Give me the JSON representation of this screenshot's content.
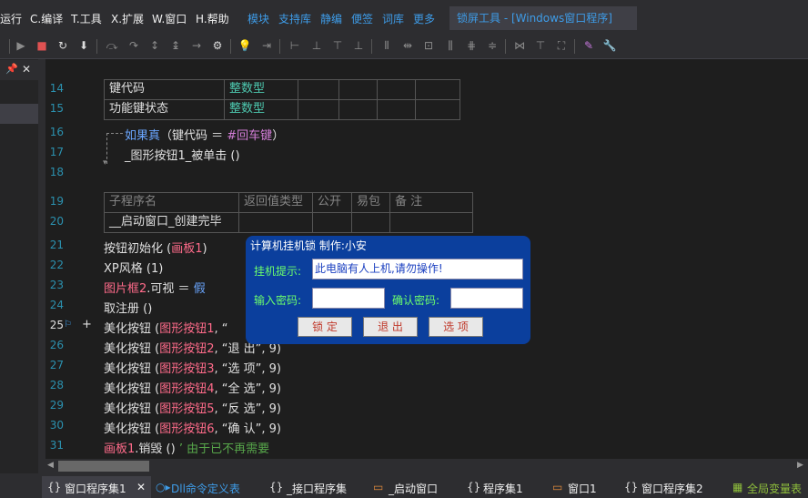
{
  "menubar": {
    "items": [
      "运行",
      "C.编译",
      "T.工具",
      "X.扩展",
      "W.窗口",
      "H.帮助"
    ],
    "links": [
      "模块",
      "支持库",
      "静编",
      "便签",
      "词库",
      "更多"
    ],
    "document_title": "锁屏工具 - [Windows窗口程序]"
  },
  "left_panel": {
    "pin_icon": "📌",
    "close_icon": "✕"
  },
  "editor": {
    "line_numbers": [
      "14",
      "15",
      "16",
      "17",
      "18",
      "19",
      "20",
      "21",
      "22",
      "23",
      "24",
      "25",
      "26",
      "27",
      "28",
      "29",
      "30",
      "31"
    ],
    "table1": {
      "rows": [
        [
          "键代码",
          "整数型"
        ],
        [
          "功能键状态",
          "整数型"
        ]
      ]
    },
    "if_line": {
      "kw": "如果真",
      "args": "（键代码 ＝ ",
      "const": "#回车键",
      "end": "）"
    },
    "call_line": "_图形按钮1_被单击 ()",
    "table2": {
      "headers": [
        "子程序名",
        "返回值类型",
        "公开",
        "易包",
        "备 注"
      ],
      "row": [
        "__启动窗口_创建完毕"
      ]
    },
    "lines": {
      "l21": {
        "a": "按钮初始化 (",
        "b": "画板1",
        "c": ")"
      },
      "l22": "XP风格 (1)",
      "l23": {
        "a": "图片框2",
        "b": ".可视 ＝ ",
        "c": "假"
      },
      "l24": "取注册 ()",
      "l25": {
        "a": "美化按钮 (",
        "b": "图形按钮1",
        "c": ", “"
      },
      "l26": {
        "a": "美化按钮 (",
        "b": "图形按钮2",
        "c": ", “退 出”, 9)"
      },
      "l27": {
        "a": "美化按钮 (",
        "b": "图形按钮3",
        "c": ", “选 项”, 9)"
      },
      "l28": {
        "a": "美化按钮 (",
        "b": "图形按钮4",
        "c": ", “全 选”, 9)"
      },
      "l29": {
        "a": "美化按钮 (",
        "b": "图形按钮5",
        "c": ", “反 选”, 9)"
      },
      "l30": {
        "a": "美化按钮 (",
        "b": "图形按钮6",
        "c": ", “确 认”, 9)"
      },
      "l31": {
        "a": "画板1",
        "b": ".销毁 () ",
        "c": "’ 由于已不再需要"
      }
    },
    "plus_mark": "+"
  },
  "dialog": {
    "title": "计算机挂机锁 制作:小安",
    "hint_label": "挂机提示:",
    "hint_value": "此电脑有人上机,请勿操作!",
    "pwd_label": "输入密码:",
    "pwd_value": "",
    "confirm_label": "确认密码:",
    "confirm_value": "",
    "buttons": [
      "锁 定",
      "退 出",
      "选 项"
    ]
  },
  "tabs": [
    {
      "icon": "{}",
      "label": "窗口程序集1",
      "close": "✕"
    },
    {
      "icon": "○▸",
      "label": "Dll命令定义表"
    },
    {
      "icon": "{}",
      "label": "_接口程序集"
    },
    {
      "icon": "▭",
      "label": "_启动窗口"
    },
    {
      "icon": "{}",
      "label": "程序集1"
    },
    {
      "icon": "▭",
      "label": "窗口1"
    },
    {
      "icon": "{}",
      "label": "窗口程序集2"
    },
    {
      "icon": "▦",
      "label": "全局变量表"
    }
  ],
  "colors": {
    "editor_bg": "#1e1e1e",
    "line_number": "#2b91af",
    "link_blue": "#3e9ce8",
    "dialog_bg": "#0b3f9d",
    "dialog_label": "#6cff6c"
  }
}
